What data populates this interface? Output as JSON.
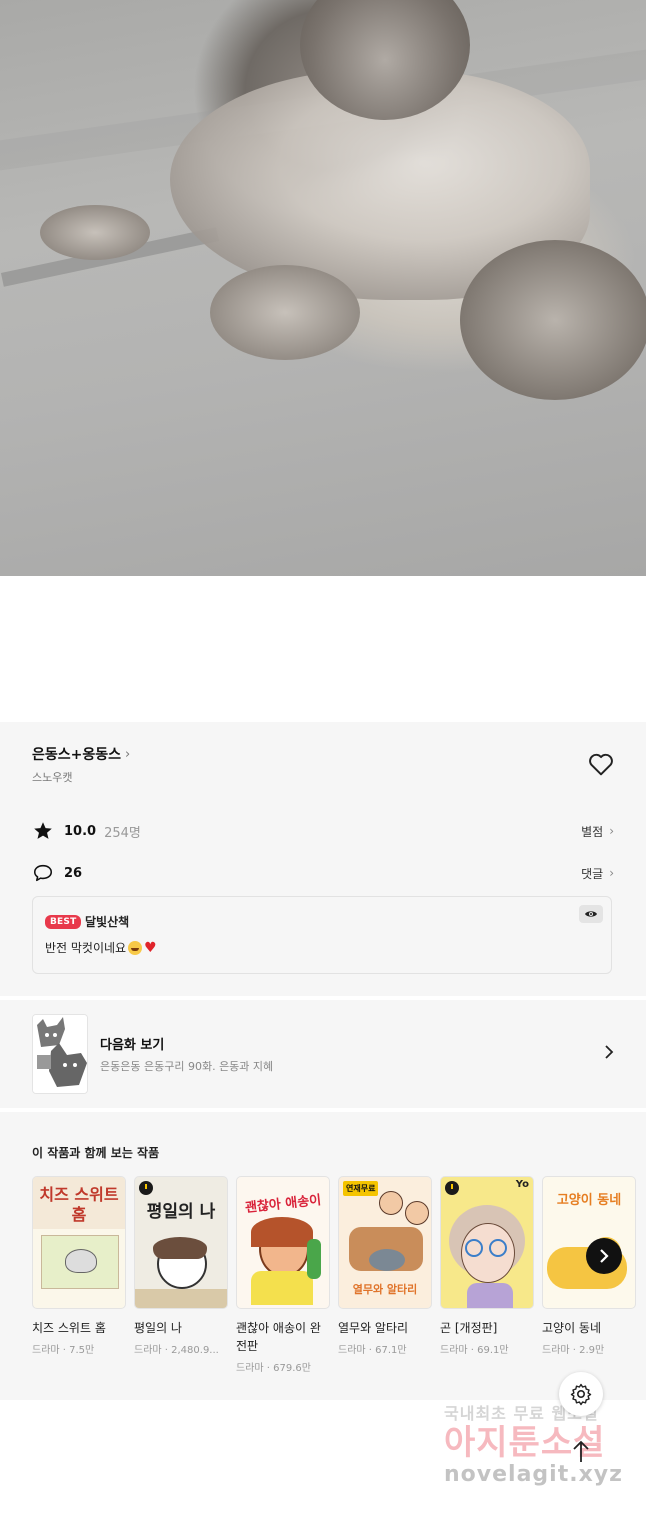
{
  "series": {
    "title": "은동스+옹동스",
    "author": "스노우캣"
  },
  "stats": {
    "rating": "10.0",
    "rating_count": "254명",
    "rating_link": "별점",
    "comment_count": "26",
    "comment_link": "댓글"
  },
  "best_comment": {
    "badge": "BEST",
    "user": "달빛산책",
    "text": "반전 막컷이네요"
  },
  "next_episode": {
    "label": "다음화 보기",
    "desc": "은동은동 은동구리 90화. 은동과 지혜"
  },
  "recommend": {
    "heading": "이 작품과 함께 보는 작품",
    "items": [
      {
        "name": "치즈 스위트 홈",
        "meta": "드라마 · 7.5만",
        "cover_text": "치즈 스위트 홈"
      },
      {
        "name": "평일의 나",
        "meta": "드라마 · 2,480.9...",
        "cover_text": "평일의 나"
      },
      {
        "name": "괜찮아 애송이 완전판",
        "meta": "드라마 · 679.6만",
        "cover_text": "괜찮아 애송이"
      },
      {
        "name": "열무와 알타리",
        "meta": "드라마 · 67.1만",
        "cover_text": "열무와 알타리",
        "badge": "연재무료"
      },
      {
        "name": "곤 [개정판]",
        "meta": "드라마 · 69.1만",
        "cover_text": "Yo"
      },
      {
        "name": "고양이 동네",
        "meta": "드라마 · 2.9만",
        "cover_text": "고양이 동네"
      }
    ]
  },
  "watermark": {
    "line1": "국내최초 무료 웹소설",
    "line2": "아지툰소설",
    "line3": "novelagit.xyz"
  },
  "icons": {
    "heart": "heart-outline-icon",
    "star": "star-icon",
    "comment": "speech-bubble-icon",
    "eye": "eye-icon",
    "next_arrow": "chevron-right-icon",
    "settings": "gear-icon",
    "scroll_top": "arrow-up-icon"
  },
  "colors": {
    "best_badge": "#e8394b",
    "panel_bg": "#f6f6f6"
  }
}
